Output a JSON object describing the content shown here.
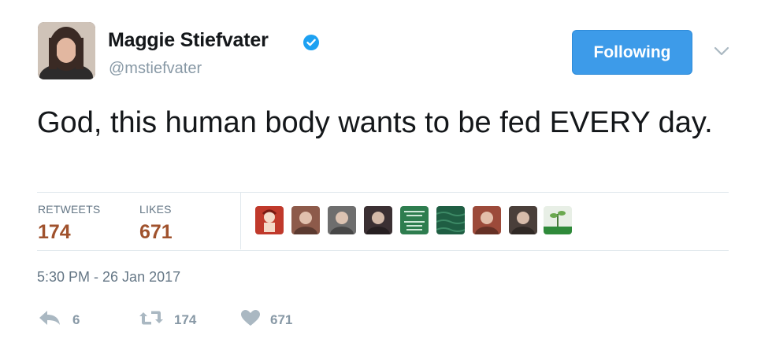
{
  "user": {
    "display_name": "Maggie Stiefvater",
    "handle": "@mstiefvater",
    "verified": true,
    "follow_button_label": "Following"
  },
  "tweet": {
    "text": "God, this human body wants to be fed EVERY day.",
    "timestamp": "5:30 PM - 26 Jan 2017"
  },
  "stats": {
    "retweets_label": "RETWEETS",
    "retweets_value": "174",
    "likes_label": "LIKES",
    "likes_value": "671"
  },
  "actions": {
    "reply_count": "6",
    "retweet_count": "174",
    "like_count": "671"
  },
  "colors": {
    "accent": "#3d9be9",
    "stat_value": "#a0522d",
    "muted": "#8899a6"
  },
  "likers": [
    {
      "icon": "avatar-red-illustration",
      "bg": "#c0392b"
    },
    {
      "icon": "avatar-woman-selfie",
      "bg": "#8d5a4a"
    },
    {
      "icon": "avatar-bw-portrait",
      "bg": "#6e6e6e"
    },
    {
      "icon": "avatar-dark-portrait",
      "bg": "#3b3033"
    },
    {
      "icon": "avatar-green-quote-card",
      "bg": "#2e7d4f"
    },
    {
      "icon": "avatar-green-water",
      "bg": "#1f5e43"
    },
    {
      "icon": "avatar-red-hair-portrait",
      "bg": "#9c4a3a"
    },
    {
      "icon": "avatar-man-portrait",
      "bg": "#4a3f3a"
    },
    {
      "icon": "avatar-plant-sprout",
      "bg": "#e8efe6"
    }
  ]
}
